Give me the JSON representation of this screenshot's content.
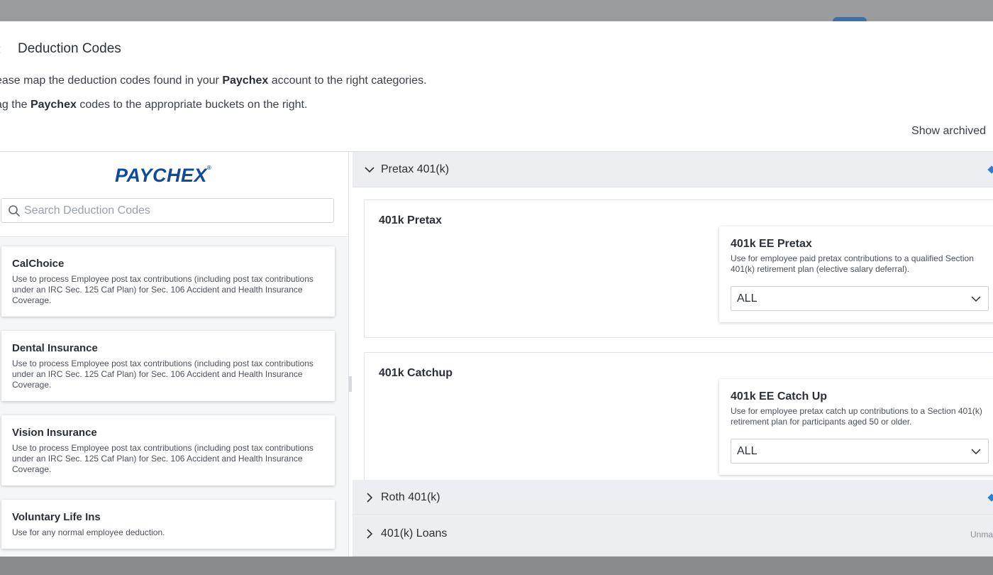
{
  "modal": {
    "title": "Deduction Codes",
    "instruction1": {
      "prefix": "ease map the deduction codes found in your ",
      "provider": "Paychex",
      "suffix": " account to the right categories."
    },
    "instruction2": {
      "prefix": "ag the ",
      "provider": "Paychex",
      "suffix": " codes to the appropriate buckets on the right."
    },
    "show_archived": "Show archived"
  },
  "left": {
    "logo_text": "PAYCHEX",
    "logo_mark": "®",
    "search_placeholder": "Search Deduction Codes",
    "codes": [
      {
        "name": "CalChoice",
        "description": "Use to process Employee post tax contributions (including post tax contributions under an IRC Sec. 125 Caf Plan) for Sec. 106 Accident and Health Insurance Coverage."
      },
      {
        "name": "Dental Insurance",
        "description": "Use to process Employee post tax contributions (including post tax contributions under an IRC Sec. 125 Caf Plan) for Sec. 106 Accident and Health Insurance Coverage."
      },
      {
        "name": "Vision Insurance",
        "description": "Use to process Employee post tax contributions (including post tax contributions under an IRC Sec. 125 Caf Plan) for Sec. 106 Accident and Health Insurance Coverage."
      },
      {
        "name": "Voluntary Life Ins",
        "description": "Use for any normal employee deduction."
      }
    ]
  },
  "right": {
    "sections": [
      {
        "label": "Pretax 401(k)",
        "expanded": true
      },
      {
        "label": "Roth 401(k)",
        "expanded": false
      },
      {
        "label": "401(k) Loans",
        "expanded": false,
        "status": "Unma"
      }
    ],
    "categories": [
      {
        "title": "401k Pretax",
        "mapped": {
          "name": "401k EE Pretax",
          "description": "Use for employee paid pretax contributions to a qualified Section 401(k) retirement plan (elective salary deferral).",
          "select_value": "ALL"
        }
      },
      {
        "title": "401k Catchup",
        "mapped": {
          "name": "401k EE Catch Up",
          "description": "Use for employee pretax catch up contributions to a Section 401(k) retirement plan for participants aged 50 or older.",
          "select_value": "ALL"
        }
      }
    ]
  },
  "colors": {
    "accent": "#2a7fd4",
    "logo": "#0f4a9c"
  }
}
